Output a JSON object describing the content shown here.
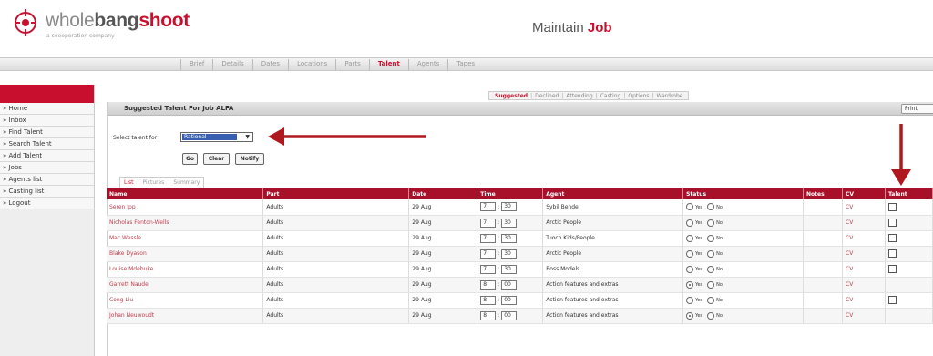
{
  "brand": {
    "name_part1": "whole",
    "name_part2": "bang",
    "name_part3": "shoot",
    "tagline": "a ceeeporation company"
  },
  "header": {
    "title_prefix": "Maintain ",
    "title_highlight": "Job"
  },
  "topnav": [
    "Brief",
    "Details",
    "Dates",
    "Locations",
    "Parts",
    "Talent",
    "Agents",
    "Tapes"
  ],
  "topnav_active": 5,
  "sidebar": {
    "items": [
      "» Home",
      "» Inbox",
      "» Find Talent",
      "» Search Talent",
      "» Add Talent",
      "» Jobs",
      "» Agents list",
      "» Casting list",
      "» Logout"
    ]
  },
  "subtabs": [
    "Suggested",
    "Declined",
    "Attending",
    "Casting",
    "Options",
    "Wardrobe"
  ],
  "panel": {
    "title": "Suggested Talent For Job ALFA",
    "print_label": "Print",
    "select_label": "Select talent for",
    "select_value": "Rational",
    "buttons": {
      "go": "Go",
      "clear": "Clear",
      "notify": "Notify"
    }
  },
  "viewtabs": [
    "List",
    "Pictures",
    "Summary"
  ],
  "table": {
    "headers": [
      "Name",
      "Part",
      "Date",
      "Time",
      "Agent",
      "Status",
      "Notes",
      "CV",
      "Talent"
    ],
    "rows": [
      {
        "name": "Seren Ipp",
        "part": "Adults",
        "date": "29 Aug",
        "hour": "7",
        "minute": "30",
        "agent": "Sybil Bende",
        "status": "",
        "cv": "CV",
        "talent_checkbox": true
      },
      {
        "name": "Nicholas Fenton-Wells",
        "part": "Adults",
        "date": "29 Aug",
        "hour": "7",
        "minute": "30",
        "agent": "Arctic People",
        "status": "",
        "cv": "CV",
        "talent_checkbox": true
      },
      {
        "name": "Mac Wessle",
        "part": "Adults",
        "date": "29 Aug",
        "hour": "7",
        "minute": "30",
        "agent": "Tuoco Kids/People",
        "status": "",
        "cv": "CV",
        "talent_checkbox": true
      },
      {
        "name": "Blake Dyason",
        "part": "Adults",
        "date": "29 Aug",
        "hour": "7",
        "minute": "30",
        "agent": "Arctic People",
        "status": "",
        "cv": "CV",
        "talent_checkbox": true
      },
      {
        "name": "Louise Mdebuke",
        "part": "Adults",
        "date": "29 Aug",
        "hour": "7",
        "minute": "30",
        "agent": "Boss Models",
        "status": "",
        "cv": "CV",
        "talent_checkbox": true
      },
      {
        "name": "Garrett Naude",
        "part": "Adults",
        "date": "29 Aug",
        "hour": "8",
        "minute": "00",
        "agent": "Action features and extras",
        "status": "yes",
        "cv": "CV",
        "talent_checkbox": false
      },
      {
        "name": "Cong Liu",
        "part": "Adults",
        "date": "29 Aug",
        "hour": "8",
        "minute": "00",
        "agent": "Action features and extras",
        "status": "",
        "cv": "CV",
        "talent_checkbox": true
      },
      {
        "name": "Johan Neuwoudt",
        "part": "Adults",
        "date": "29 Aug",
        "hour": "8",
        "minute": "00",
        "agent": "Action features and extras",
        "status": "yes",
        "cv": "CV",
        "talent_checkbox": false
      }
    ],
    "yes_label": "Yes",
    "no_label": "No"
  },
  "colors": {
    "brand_red": "#c8102e",
    "header_row": "#a8102a",
    "annotation_arrow": "#b01820"
  }
}
